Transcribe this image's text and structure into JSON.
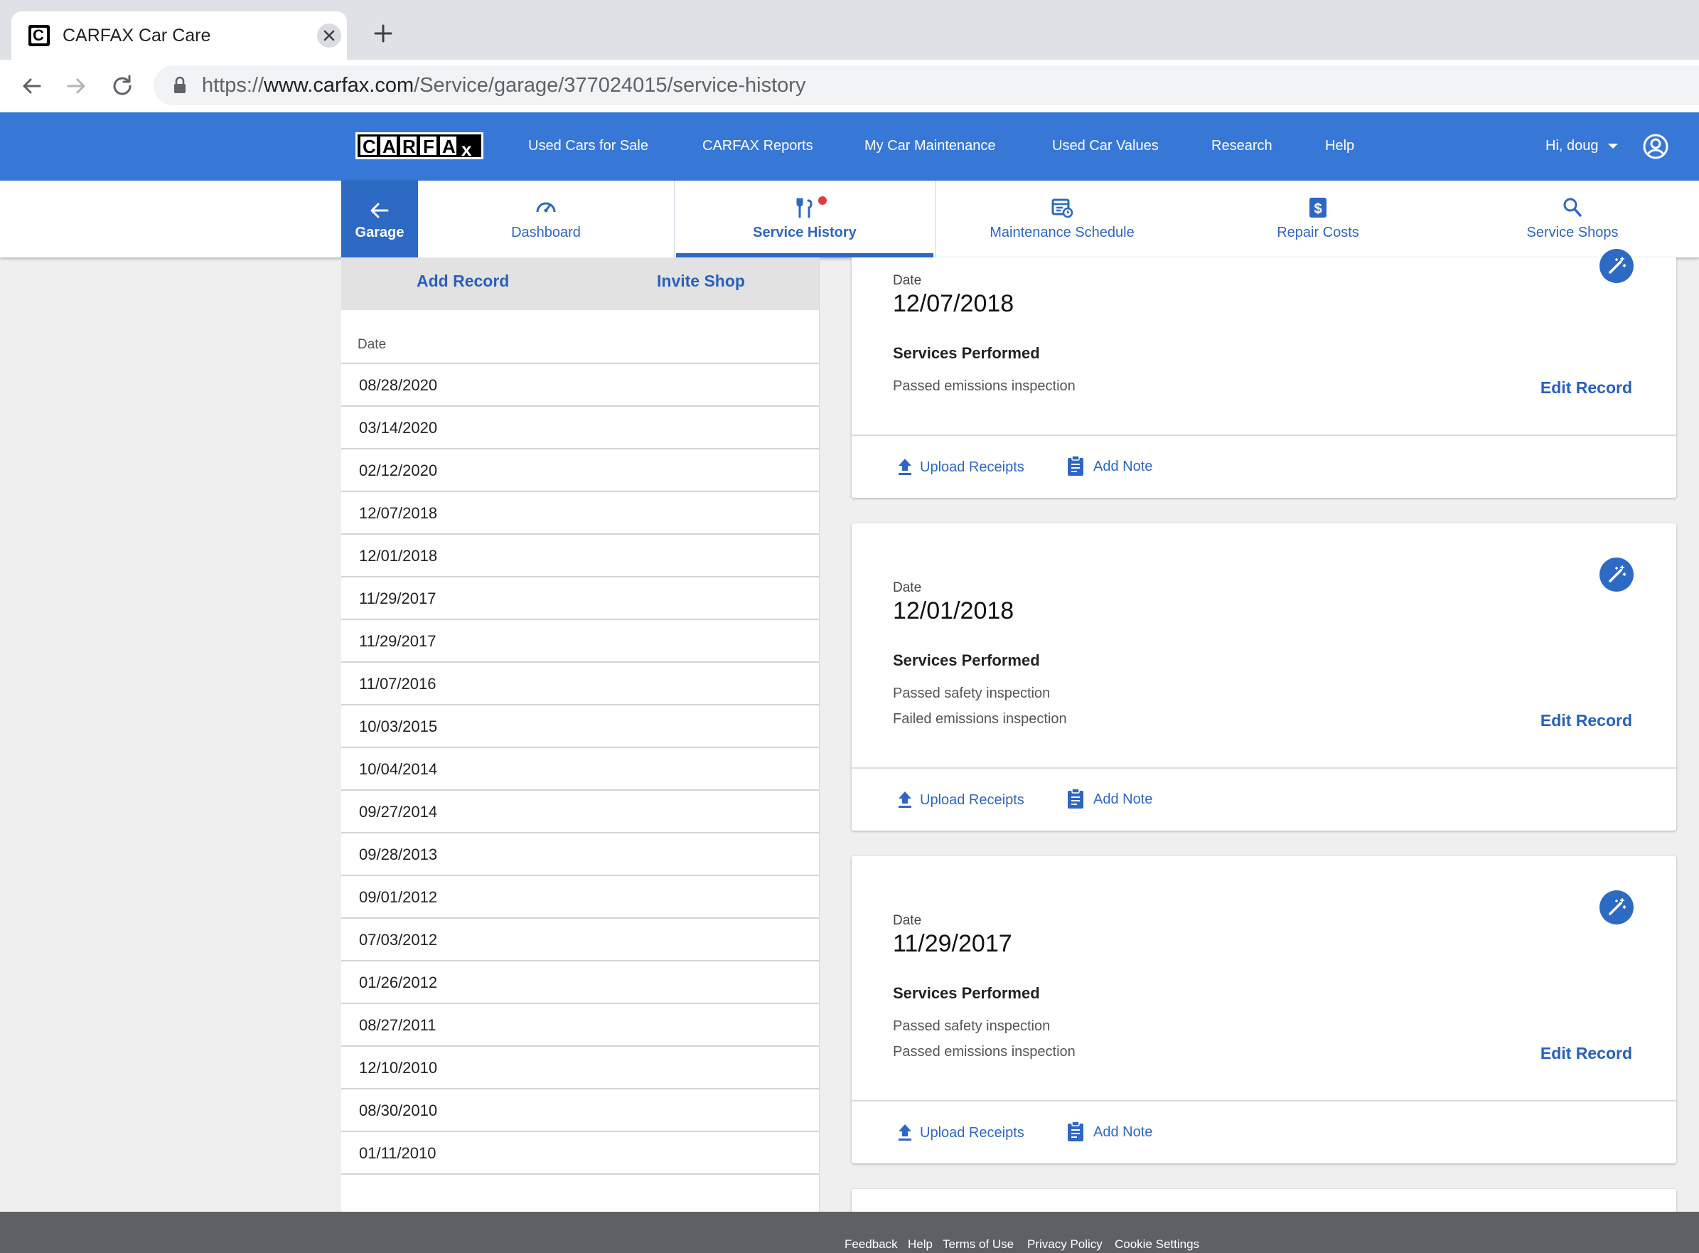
{
  "browser": {
    "tab_title": "CARFAX Car Care",
    "favicon_letter": "C",
    "url_prefix": "https://",
    "url_host": "www.carfax.com",
    "url_path": "/Service/garage/377024015/service-history"
  },
  "topnav": {
    "logo_text": "CARFAX",
    "links": [
      "Used Cars for Sale",
      "CARFAX Reports",
      "My Car Maintenance",
      "Used Car Values",
      "Research",
      "Help"
    ],
    "greeting": "Hi, doug"
  },
  "subnav": {
    "garage": "Garage",
    "tabs": [
      "Dashboard",
      "Service History",
      "Maintenance Schedule",
      "Repair Costs",
      "Service Shops"
    ],
    "active": "Service History",
    "accent": "#2d6ac4"
  },
  "leftpanel": {
    "add_record": "Add Record",
    "invite_shop": "Invite Shop",
    "date_header": "Date",
    "dates": [
      "08/28/2020",
      "03/14/2020",
      "02/12/2020",
      "12/07/2018",
      "12/01/2018",
      "11/29/2017",
      "11/29/2017",
      "11/07/2016",
      "10/03/2015",
      "10/04/2014",
      "09/27/2014",
      "09/28/2013",
      "09/01/2012",
      "07/03/2012",
      "01/26/2012",
      "08/27/2011",
      "12/10/2010",
      "08/30/2010",
      "01/11/2010"
    ]
  },
  "records": [
    {
      "date_label": "Date",
      "date": "12/07/2018",
      "services_label": "Services Performed",
      "services": [
        "Passed emissions inspection"
      ],
      "edit": "Edit Record",
      "upload": "Upload Receipts",
      "note": "Add Note"
    },
    {
      "date_label": "Date",
      "date": "12/01/2018",
      "services_label": "Services Performed",
      "services": [
        "Passed safety inspection",
        "Failed emissions inspection"
      ],
      "edit": "Edit Record",
      "upload": "Upload Receipts",
      "note": "Add Note"
    },
    {
      "date_label": "Date",
      "date": "11/29/2017",
      "services_label": "Services Performed",
      "services": [
        "Passed safety inspection",
        "Passed emissions inspection"
      ],
      "edit": "Edit Record",
      "upload": "Upload Receipts",
      "note": "Add Note"
    }
  ],
  "footer": {
    "links": [
      "Feedback",
      "Help",
      "Terms of Use",
      "Privacy Policy",
      "Cookie Settings"
    ]
  }
}
